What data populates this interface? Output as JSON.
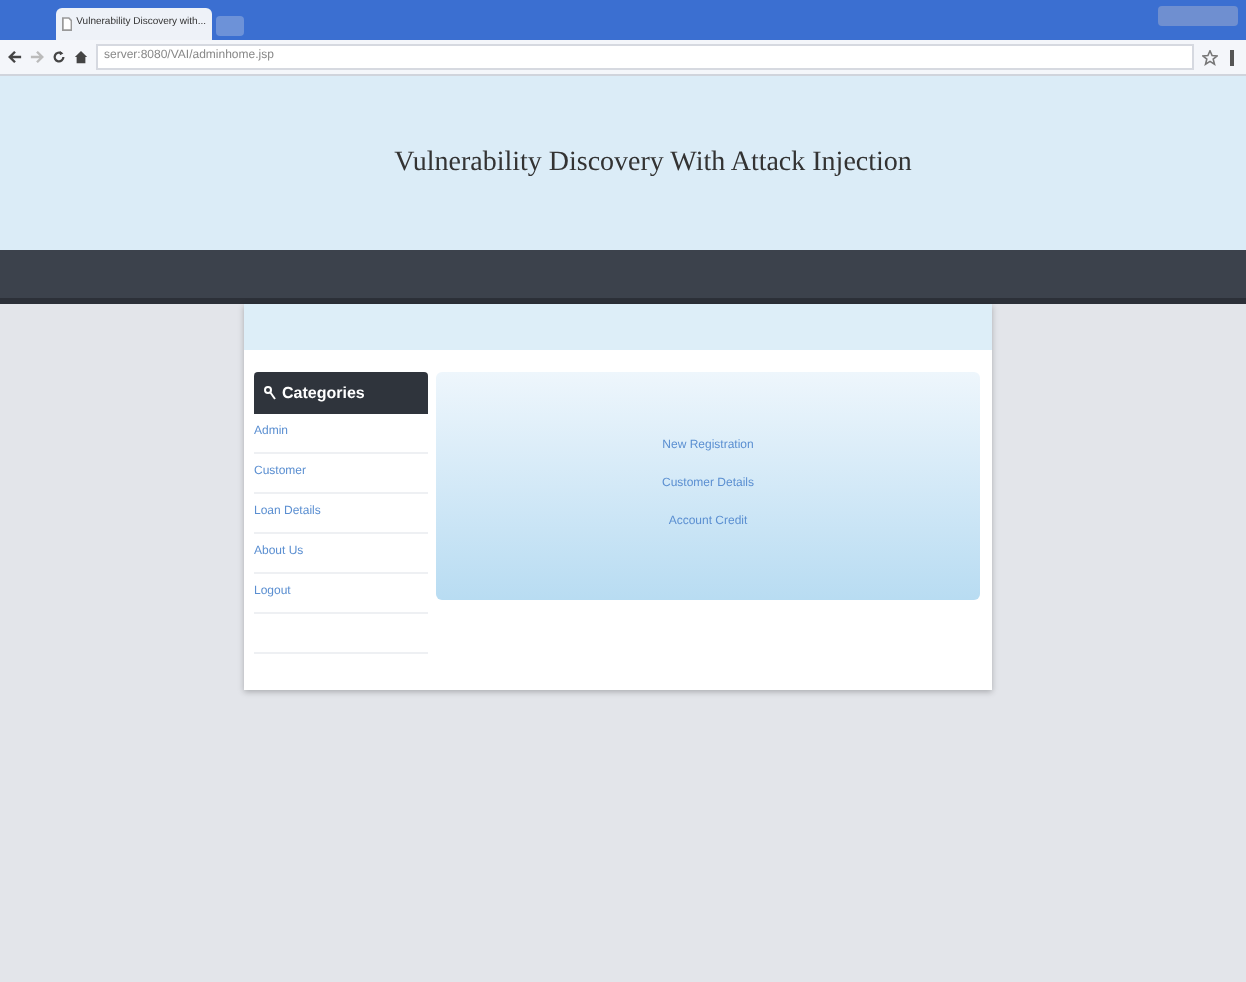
{
  "browser": {
    "tab_title": "Vulnerability Discovery with...",
    "address": "server:8080/VAI/adminhome.jsp"
  },
  "header": {
    "title": "Vulnerability Discovery With Attack Injection"
  },
  "sidebar": {
    "title": "Categories",
    "items": [
      {
        "label": "Admin"
      },
      {
        "label": "Customer"
      },
      {
        "label": "Loan Details"
      },
      {
        "label": "About Us"
      },
      {
        "label": "Logout"
      }
    ]
  },
  "content": {
    "links": [
      {
        "label": "New Registration"
      },
      {
        "label": "Customer Details"
      },
      {
        "label": "Account Credit"
      }
    ]
  }
}
